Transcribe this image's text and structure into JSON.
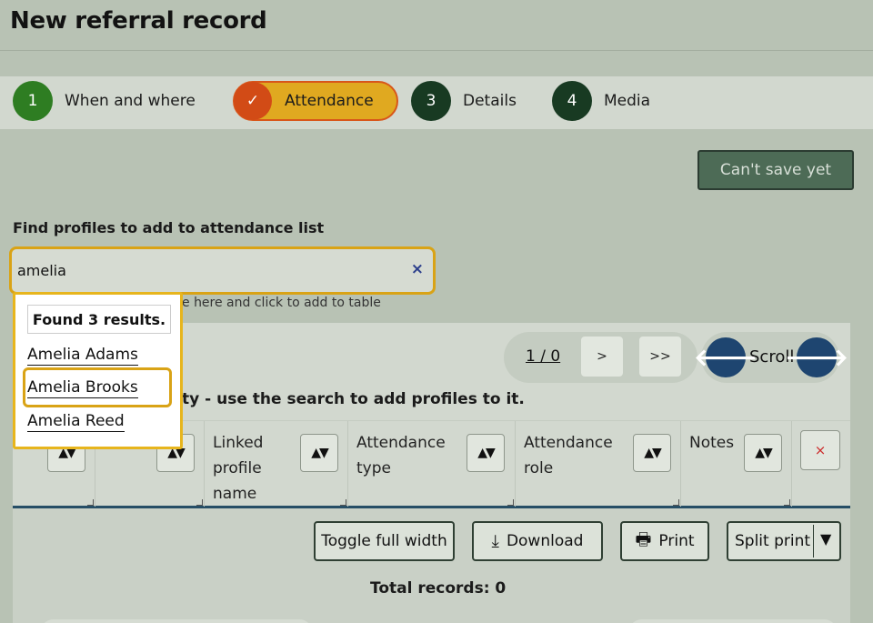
{
  "page": {
    "title": "New referral record"
  },
  "steps": [
    {
      "number": "1",
      "label": "When and where"
    },
    {
      "number": "✓",
      "label": "Attendance"
    },
    {
      "number": "3",
      "label": "Details"
    },
    {
      "number": "4",
      "label": "Media"
    }
  ],
  "save_button": {
    "label": "Can't save yet"
  },
  "search": {
    "label": "Find profiles to add to attendance list",
    "value": "amelia",
    "clear_icon": "×",
    "hint_partial": "e here and click to add to table"
  },
  "results": {
    "header": "Found 3 results.",
    "items": [
      "Amelia Adams",
      "Amelia Brooks",
      "Amelia Reed"
    ],
    "focused_index": 1
  },
  "pager": {
    "count": "1 / 0",
    "next_label": ">",
    "last_label": ">>",
    "scroll_label": "Scroll",
    "scroll_left_icon": "🡐",
    "scroll_right_icon": "🡒"
  },
  "table": {
    "empty_partial": "ty - use the search to add profiles to it.",
    "sort_icon": "▲▼",
    "clear_icon": "×",
    "columns": [
      {
        "name": ""
      },
      {
        "name": ""
      },
      {
        "name": "Linked\nprofile\nname"
      },
      {
        "name": "Attendance\ntype"
      },
      {
        "name": "Attendance\nrole"
      },
      {
        "name": "Notes"
      }
    ],
    "total_label": "Total records: 0"
  },
  "actions": {
    "toggle_full_width": "Toggle full width",
    "download": "Download",
    "print": "Print",
    "split_print": "Split print",
    "split_caret": "▼",
    "download_icon": "⤓",
    "print_icon": "🖶"
  }
}
